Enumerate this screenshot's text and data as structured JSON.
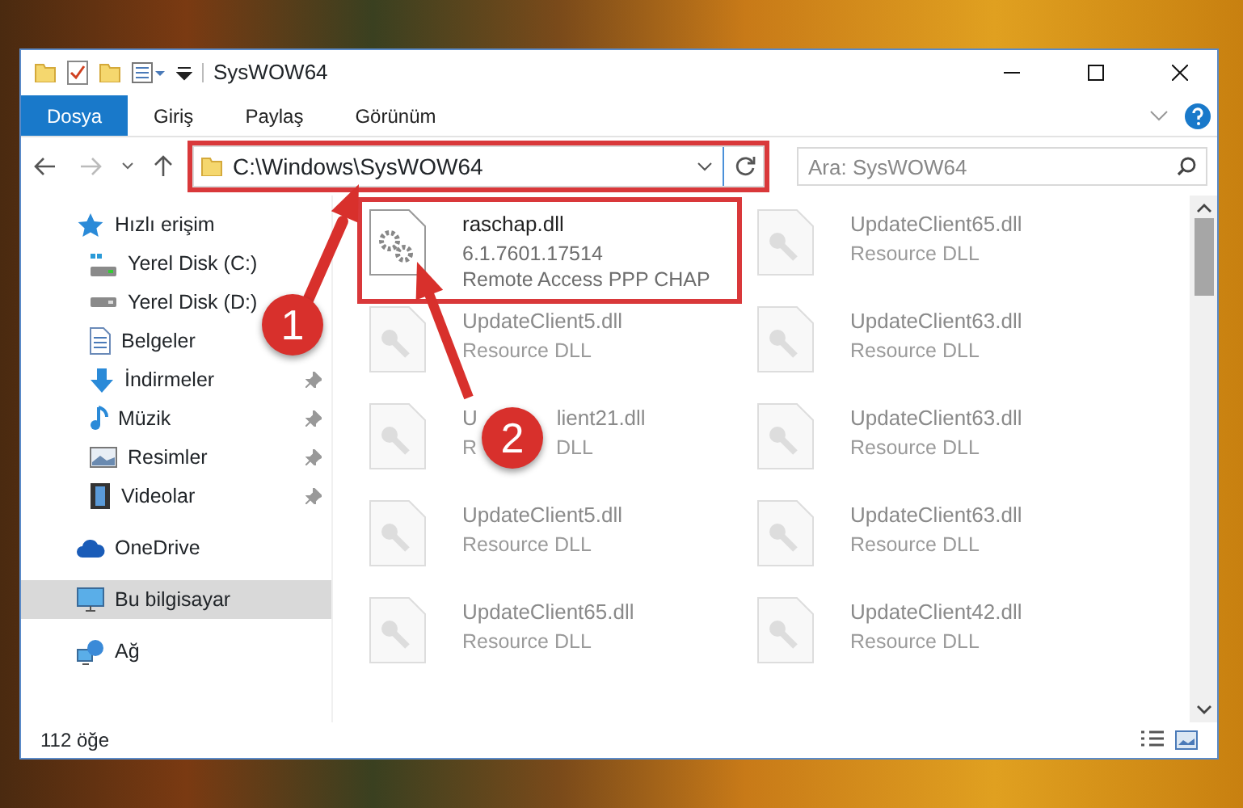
{
  "window": {
    "title": "SysWOW64"
  },
  "ribbon_tabs": [
    {
      "label": "Dosya",
      "selected": true
    },
    {
      "label": "Giriş",
      "selected": false
    },
    {
      "label": "Paylaş",
      "selected": false
    },
    {
      "label": "Görünüm",
      "selected": false
    }
  ],
  "address_bar": {
    "path": "C:\\Windows\\SysWOW64",
    "highlighted": true
  },
  "search": {
    "placeholder": "Ara: SysWOW64"
  },
  "sidebar": {
    "items": [
      {
        "label": "Hızlı erişim",
        "kind": "quick-access",
        "selected": false,
        "children": [
          {
            "label": "Yerel Disk (C:)",
            "kind": "system-drive",
            "selected": false,
            "pinned": false
          },
          {
            "label": "Yerel Disk (D:)",
            "kind": "drive",
            "selected": false,
            "pinned": false
          },
          {
            "label": "Belgeler",
            "kind": "documents",
            "selected": false,
            "pinned": false
          },
          {
            "label": "İndirmeler",
            "kind": "downloads",
            "selected": false,
            "pinned": true
          },
          {
            "label": "Müzik",
            "kind": "music",
            "selected": false,
            "pinned": true
          },
          {
            "label": "Resimler",
            "kind": "pictures",
            "selected": false,
            "pinned": true
          },
          {
            "label": "Videolar",
            "kind": "videos",
            "selected": false,
            "pinned": true
          }
        ]
      },
      {
        "label": "OneDrive",
        "kind": "cloud",
        "selected": false
      },
      {
        "label": "Bu bilgisayar",
        "kind": "computer",
        "selected": true
      },
      {
        "label": "Ağ",
        "kind": "network",
        "selected": false
      }
    ]
  },
  "files": [
    {
      "name": [
        "raschap.dll"
      ],
      "lines": [
        [
          "6.1.7601.17514"
        ],
        [
          "Remote Access PPP CHAP"
        ]
      ],
      "kind": "gear",
      "highlighted": true
    },
    {
      "name": [
        "UpdateClient5.dll"
      ],
      "lines": [
        [
          "Resource DLL"
        ]
      ],
      "kind": "faded",
      "highlighted": false
    },
    {
      "name": [
        "U",
        "lient21.dll"
      ],
      "lines": [
        [
          "R",
          "DLL"
        ]
      ],
      "kind": "faded",
      "highlighted": false
    },
    {
      "name": [
        "UpdateClient5.dll"
      ],
      "lines": [
        [
          "Resource DLL"
        ]
      ],
      "kind": "faded",
      "highlighted": false
    },
    {
      "name": [
        "UpdateClient65.dll"
      ],
      "lines": [
        [
          "Resource DLL"
        ]
      ],
      "kind": "faded",
      "highlighted": false
    },
    {
      "name": [
        "UpdateClient65.dll"
      ],
      "lines": [
        [
          "Resource DLL"
        ]
      ],
      "kind": "faded",
      "highlighted": false
    },
    {
      "name": [
        "UpdateClient63.dll"
      ],
      "lines": [
        [
          "Resource DLL"
        ]
      ],
      "kind": "faded",
      "highlighted": false
    },
    {
      "name": [
        "UpdateClient63.dll"
      ],
      "lines": [
        [
          "Resource DLL"
        ]
      ],
      "kind": "faded",
      "highlighted": false
    },
    {
      "name": [
        "UpdateClient63.dll"
      ],
      "lines": [
        [
          "Resource DLL"
        ]
      ],
      "kind": "faded",
      "highlighted": false
    },
    {
      "name": [
        "UpdateClient42.dll"
      ],
      "lines": [
        [
          "Resource DLL"
        ]
      ],
      "kind": "faded",
      "highlighted": false
    }
  ],
  "status_bar": {
    "item_count": "112 öğe"
  },
  "annotations": [
    {
      "label": "1"
    },
    {
      "label": "2"
    }
  ]
}
